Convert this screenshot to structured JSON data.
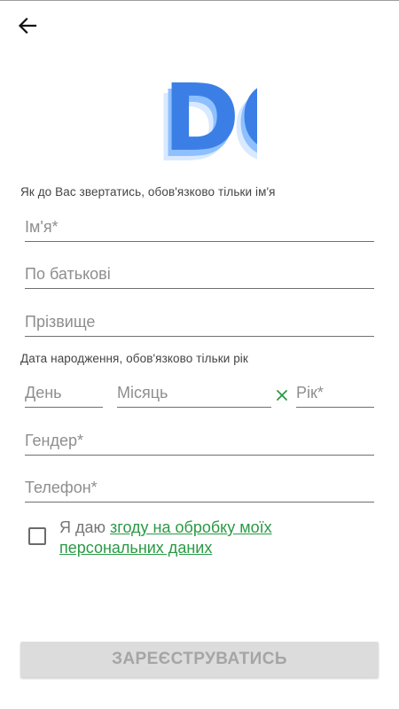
{
  "header": {
    "back_icon": "arrow-left-icon"
  },
  "logo": {
    "text": "DC",
    "colors": [
      "#2f6fe0",
      "#5fa8ff",
      "#cfe3ff"
    ]
  },
  "name_section": {
    "label": "Як до Вас звертатись, обов'язково тільки ім'я",
    "first_name_placeholder": "Ім'я*",
    "patronymic_placeholder": "По батькові",
    "last_name_placeholder": "Прізвище"
  },
  "birth_section": {
    "label": "Дата народження, обов'язково тільки рік",
    "day_placeholder": "День",
    "month_placeholder": "Місяць",
    "year_placeholder": "Рік*",
    "clear_icon": "close-icon"
  },
  "gender_placeholder": "Гендер*",
  "phone_placeholder": "Телефон*",
  "consent": {
    "checked": false,
    "prefix": "Я даю ",
    "link_text": "згоду на обробку моїх персональних даних"
  },
  "register_button_label": "ЗАРЕЄСТРУВАТИСЬ",
  "colors": {
    "accent_green": "#2a9a45",
    "button_disabled": "#dcdcdc"
  }
}
